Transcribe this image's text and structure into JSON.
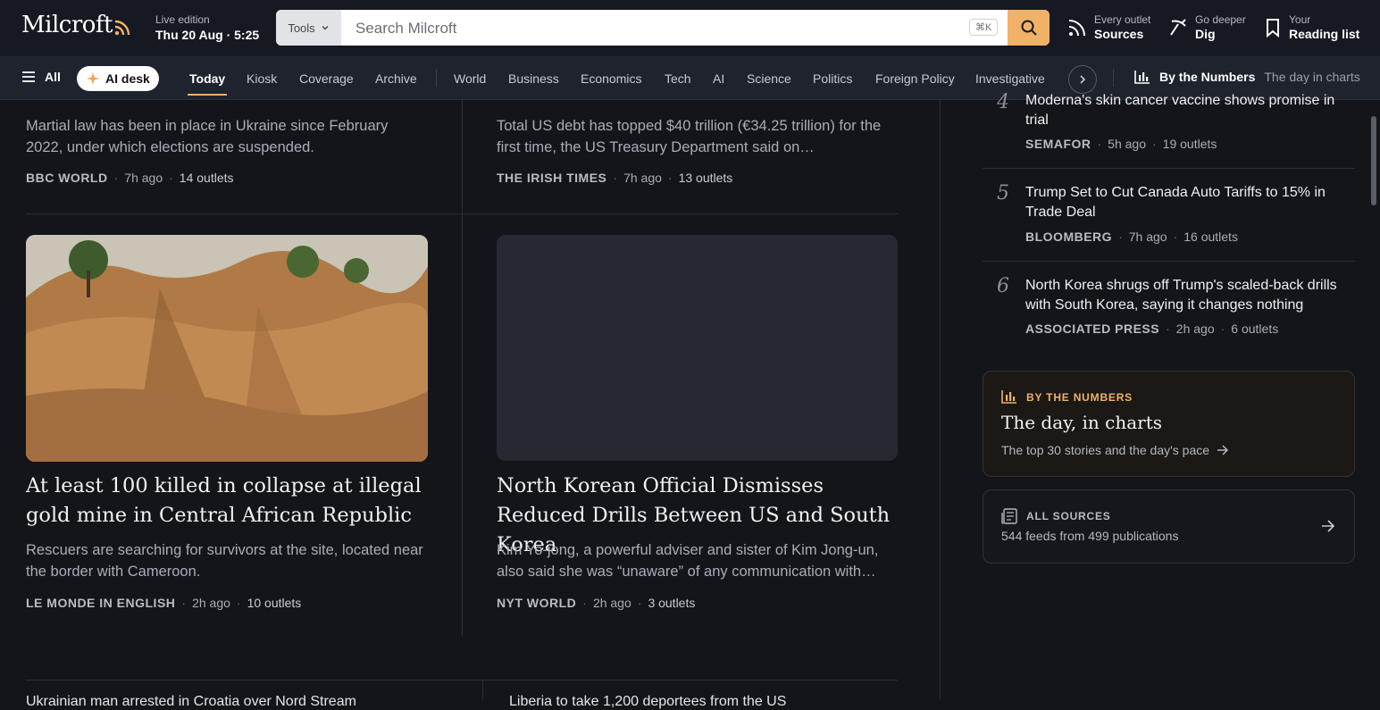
{
  "header": {
    "logo": "Milcroft",
    "edition_label": "Live edition",
    "edition_date": "Thu 20 Aug · 5:25",
    "tools_label": "Tools",
    "search_placeholder": "Search Milcroft",
    "search_shortcut": "⌘K",
    "links": [
      {
        "small": "Every outlet",
        "big": "Sources",
        "icon": "rss-icon"
      },
      {
        "small": "Go deeper",
        "big": "Dig",
        "icon": "pickaxe-icon"
      },
      {
        "small": "Your",
        "big": "Reading list",
        "icon": "bookmark-icon"
      }
    ]
  },
  "nav": {
    "all": "All",
    "ai_desk": "AI desk",
    "primary": [
      "Today",
      "Kiosk",
      "Coverage",
      "Archive"
    ],
    "sections": [
      "World",
      "Business",
      "Economics",
      "Tech",
      "AI",
      "Science",
      "Politics",
      "Foreign Policy",
      "Investigative"
    ],
    "numbers_label": "By the Numbers",
    "numbers_sub": "The day in charts"
  },
  "main": {
    "top_left": {
      "summary": "Martial law has been in place in Ukraine since February 2022, under which elections are suspended.",
      "source": "BBC WORLD",
      "time": "7h ago",
      "outlets": "14 outlets"
    },
    "top_right": {
      "summary": "Total US debt has topped $40 trillion (€34.25 trillion) for the first time, the US Treasury Department said on…",
      "source": "THE IRISH TIMES",
      "time": "7h ago",
      "outlets": "13 outlets"
    },
    "card_left": {
      "headline": "At least 100 killed in collapse at illegal gold mine in Central African Republic",
      "summary": "Rescuers are searching for survivors at the site, located near the border with Cameroon.",
      "source": "LE MONDE IN ENGLISH",
      "time": "2h ago",
      "outlets": "10 outlets"
    },
    "card_right": {
      "headline": "North Korean Official Dismisses Reduced Drills Between US and South Korea",
      "summary": "Kim Yo-jong, a powerful adviser and sister of Kim Jong-un, also said she was “unaware” of any communication with…",
      "source": "NYT WORLD",
      "time": "2h ago",
      "outlets": "3 outlets"
    },
    "bottom_left_title": "Ukrainian man arrested in Croatia over Nord Stream",
    "bottom_right_title": "Liberia to take 1,200 deportees from the US"
  },
  "sidebar": {
    "items": [
      {
        "num": "4",
        "title": "Moderna's skin cancer vaccine shows promise in trial",
        "source": "SEMAFOR",
        "time": "5h ago",
        "outlets": "19 outlets"
      },
      {
        "num": "5",
        "title": "Trump Set to Cut Canada Auto Tariffs to 15% in Trade Deal",
        "source": "BLOOMBERG",
        "time": "7h ago",
        "outlets": "16 outlets"
      },
      {
        "num": "6",
        "title": "North Korea shrugs off Trump's scaled-back drills with South Korea, saying it changes nothing",
        "source": "ASSOCIATED PRESS",
        "time": "2h ago",
        "outlets": "6 outlets"
      }
    ],
    "numbers_card": {
      "kicker": "BY THE NUMBERS",
      "title": "The day, in charts",
      "sub": "The top 30 stories and the day's pace"
    },
    "sources_card": {
      "kicker": "ALL SOURCES",
      "sub": "544 feeds from 499 publications"
    }
  },
  "colors": {
    "accent": "#f1b267",
    "background": "#13151b",
    "nav_bg": "#1f232d"
  }
}
